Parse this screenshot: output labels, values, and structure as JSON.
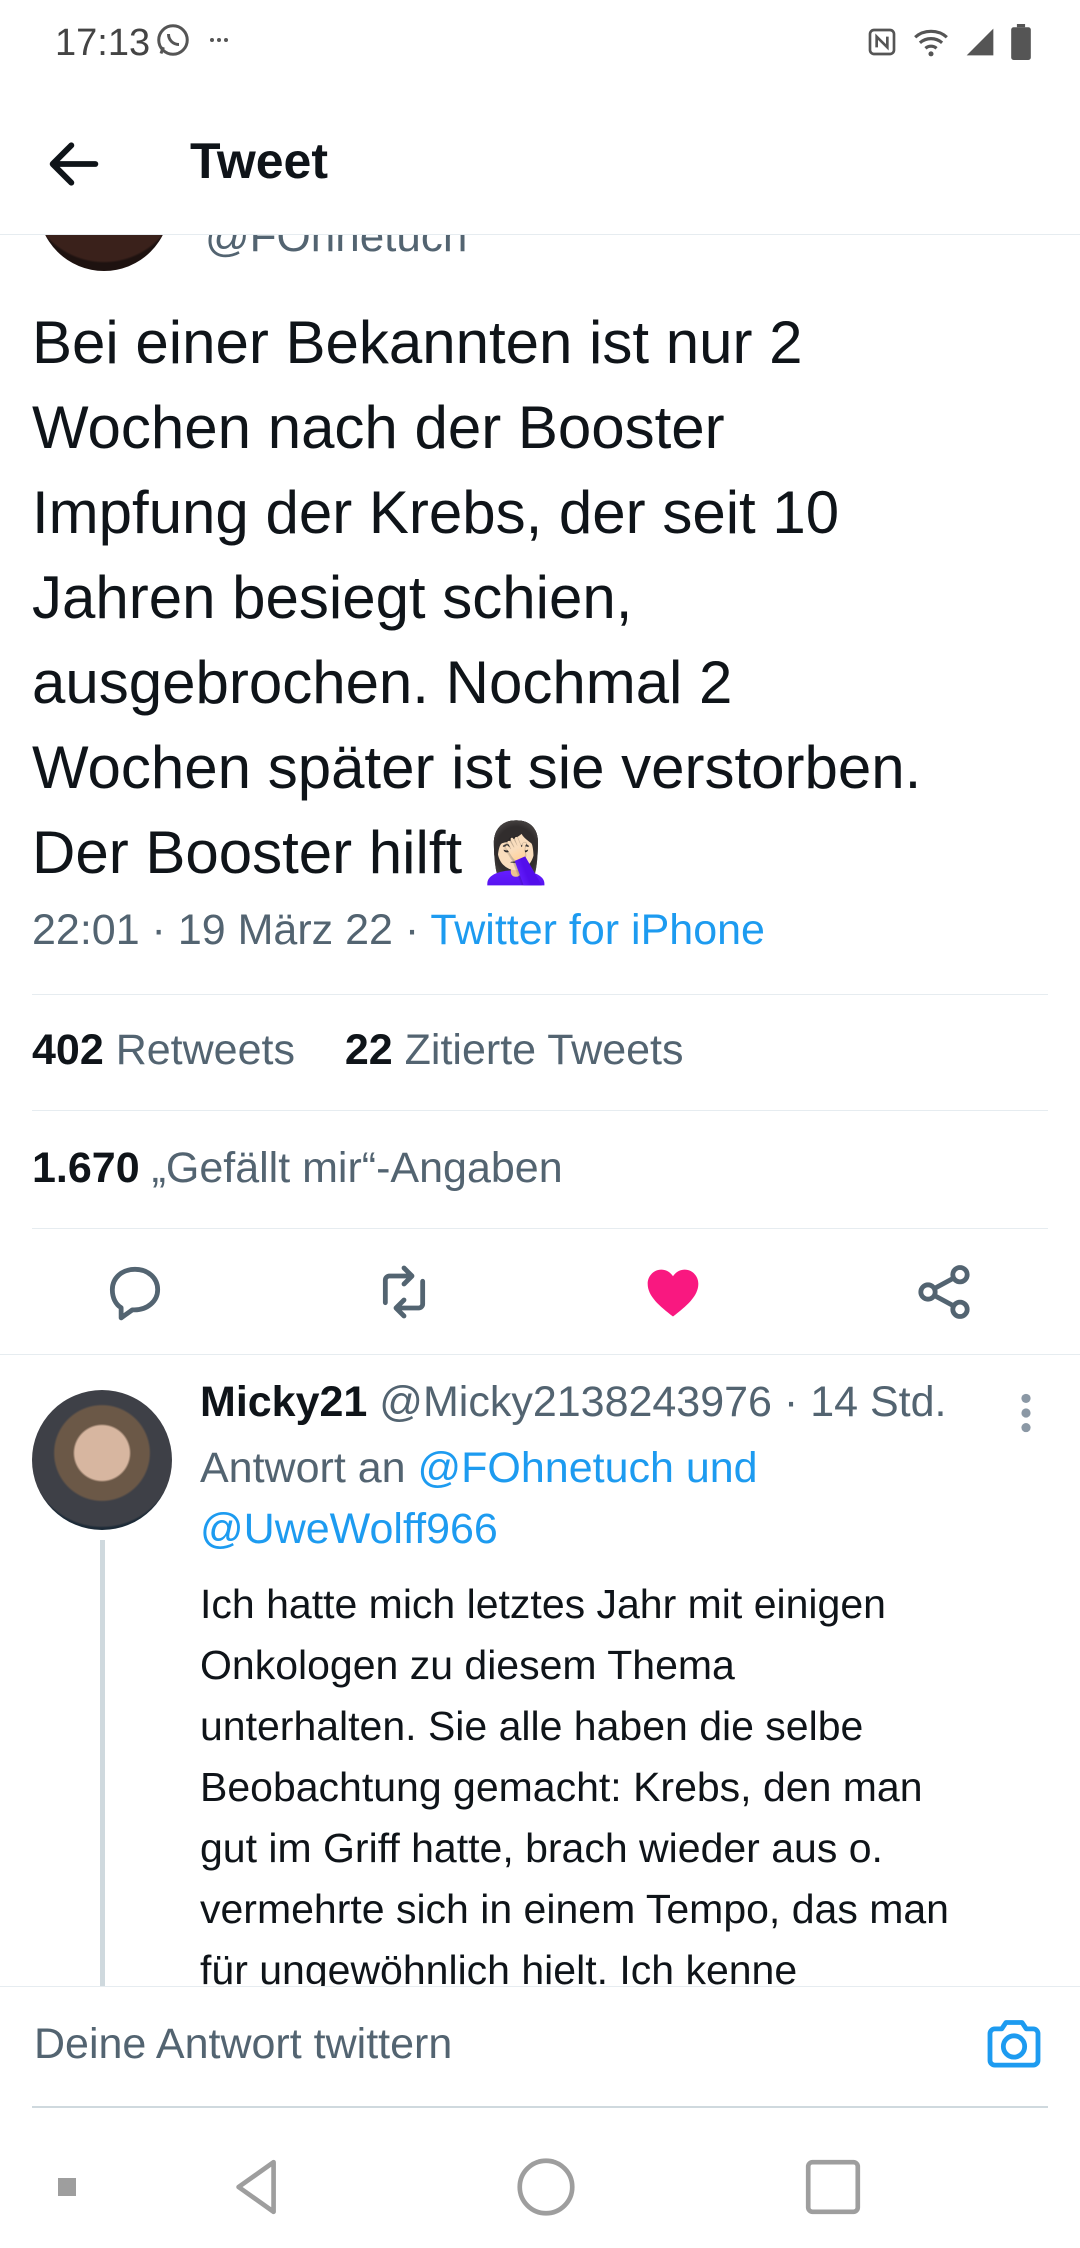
{
  "status_bar": {
    "time": "17:13"
  },
  "header": {
    "title": "Tweet"
  },
  "tweet": {
    "handle": "@FOhnetuch",
    "text": "Bei einer Bekannten ist nur 2\nWochen nach der Booster\nImpfung der Krebs, der seit 10\nJahren besiegt schien,\nausgebrochen. Nochmal 2\nWochen später ist sie verstorben.\nDer Booster hilft 🤦🏻‍♀️",
    "time": "22:01 · 19 März 22 · ",
    "source": "Twitter for iPhone",
    "retweets_count": "402",
    "retweets_label": "Retweets",
    "quotes_count": "22",
    "quotes_label": "Zitierte Tweets",
    "likes_count": "1.670",
    "likes_label": "„Gefällt mir“-Angaben"
  },
  "reply": {
    "name": "Micky21",
    "handle": "@Micky2138243976",
    "time": "· 14 Std.",
    "reply_to_prefix": "Antwort an",
    "reply_to_users": "@FOhnetuch und @UweWolff966",
    "text": "Ich hatte mich letztes Jahr mit einigen\nOnkologen zu diesem Thema\nunterhalten. Sie alle haben die selbe\nBeobachtung gemacht: Krebs, den man\ngut im Griff hatte, brach wieder aus o.\nvermehrte sich in einem Tempo, das man\nfür ungewöhnlich hielt. Ich kenne"
  },
  "composer": {
    "placeholder": "Deine Antwort twittern"
  },
  "colors": {
    "accent": "#1d9bf0",
    "like": "#f91880",
    "muted": "#536471",
    "text": "#0f1419"
  }
}
